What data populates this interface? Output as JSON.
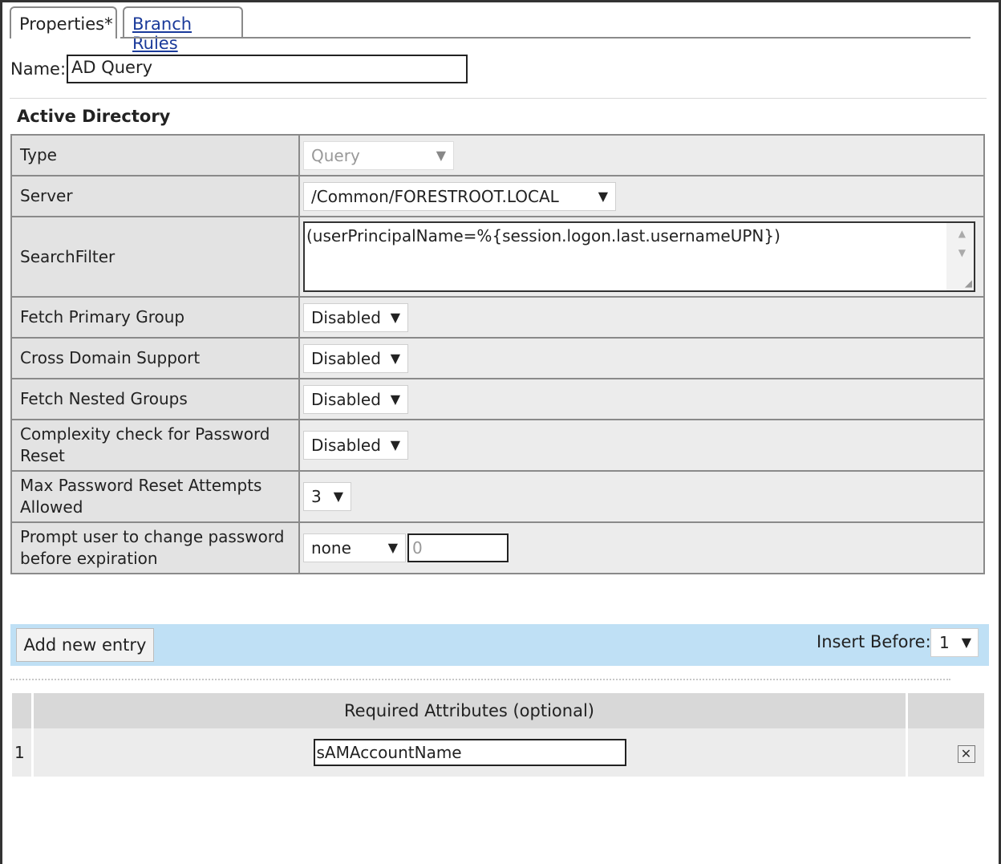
{
  "tabs": [
    {
      "label": "Properties*"
    },
    {
      "label": "Branch Rules"
    }
  ],
  "name_field": {
    "label": "Name:",
    "value": "AD Query"
  },
  "section_title": "Active Directory",
  "props": {
    "type": {
      "label": "Type",
      "value": "Query"
    },
    "server": {
      "label": "Server",
      "value": "/Common/FORESTROOT.LOCAL"
    },
    "search_filter": {
      "label": "SearchFilter",
      "value": "(userPrincipalName=%{session.logon.last.usernameUPN})"
    },
    "fetch_primary_group": {
      "label": "Fetch Primary Group",
      "value": "Disabled"
    },
    "cross_domain_support": {
      "label": "Cross Domain Support",
      "value": "Disabled"
    },
    "fetch_nested_groups": {
      "label": "Fetch Nested Groups",
      "value": "Disabled"
    },
    "complexity_check": {
      "label": "Complexity check for Password Reset",
      "value": "Disabled"
    },
    "max_reset_attempts": {
      "label": "Max Password Reset Attempts Allowed",
      "value": "3"
    },
    "prompt_change": {
      "label": "Prompt user to change password before expiration",
      "value": "none",
      "days": "0"
    }
  },
  "toolbar": {
    "add_label": "Add new entry",
    "insert_before_label": "Insert Before:",
    "insert_before_value": "1"
  },
  "attributes": {
    "header": "Required Attributes (optional)",
    "rows": [
      {
        "index": "1",
        "value": "sAMAccountName"
      }
    ]
  },
  "icons": {
    "dropdown": "▼",
    "delete": "✕"
  }
}
